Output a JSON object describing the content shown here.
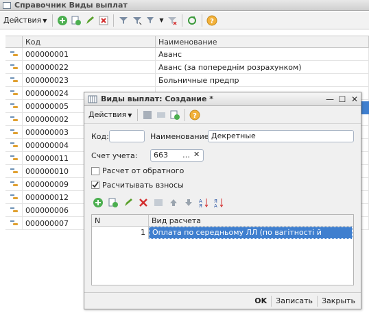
{
  "window": {
    "title": "Справочник Виды выплат"
  },
  "toolbar": {
    "actions_label": "Действия"
  },
  "grid": {
    "columns": [
      "Код",
      "Наименование"
    ],
    "rows": [
      {
        "code": "000000001",
        "name": "Аванс"
      },
      {
        "code": "000000022",
        "name": "Аванс (за попереднім розрахунком)"
      },
      {
        "code": "000000023",
        "name": "Больничные предпр"
      },
      {
        "code": "000000024",
        "name": ""
      },
      {
        "code": "000000005",
        "name": ""
      },
      {
        "code": "000000002",
        "name": ""
      },
      {
        "code": "000000003",
        "name": ""
      },
      {
        "code": "000000004",
        "name": ""
      },
      {
        "code": "000000011",
        "name": ""
      },
      {
        "code": "000000010",
        "name": ""
      },
      {
        "code": "000000009",
        "name": ""
      },
      {
        "code": "000000012",
        "name": ""
      },
      {
        "code": "000000006",
        "name": ""
      },
      {
        "code": "000000007",
        "name": ""
      }
    ]
  },
  "dialog": {
    "title": "Виды выплат: Создание *",
    "actions_label": "Действия",
    "code_label": "Код:",
    "code_value": "",
    "name_label": "Наименование:",
    "name_value": "Декретные",
    "account_label": "Счет учета:",
    "account_value": "663",
    "reverse_calc_label": "Расчет от обратного",
    "reverse_calc_checked": false,
    "calc_contrib_label": "Расчитывать взносы",
    "calc_contrib_checked": true,
    "table": {
      "columns": [
        "N",
        "Вид расчета"
      ],
      "rows": [
        {
          "n": "1",
          "kind": "Оплата по середньому ЛЛ (по вагітності й пологам)"
        }
      ]
    },
    "footer": {
      "ok_label": "OK",
      "save_label": "Записать",
      "close_label": "Закрыть"
    }
  }
}
